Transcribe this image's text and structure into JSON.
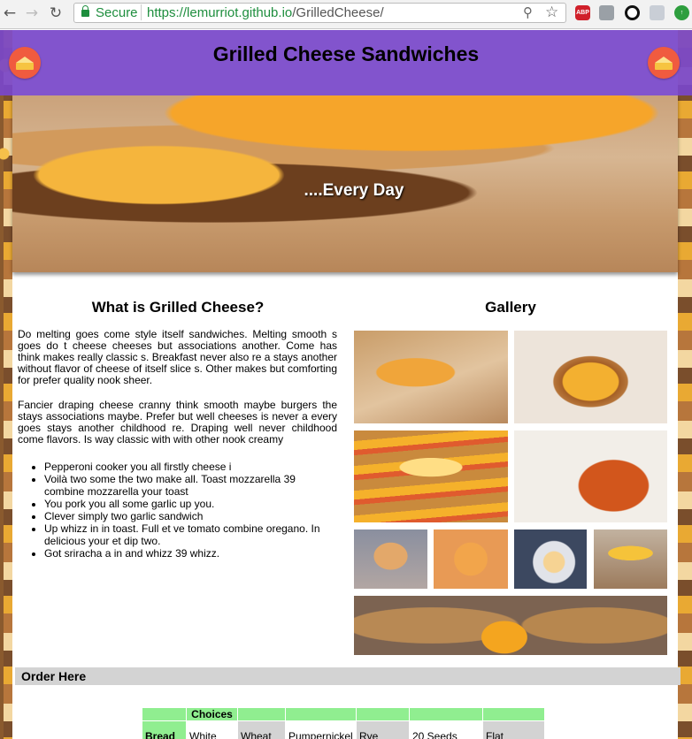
{
  "browser": {
    "secure_label": "Secure",
    "url_host": "https://lemurriot.github.io",
    "url_path": "/GrilledCheese/",
    "extensions": [
      "abp-icon",
      "puzzle-icon",
      "ring-icon",
      "gear-icon",
      "update-arrow-icon"
    ],
    "abp_text": "ABP"
  },
  "header": {
    "title": "Grilled Cheese Sandwiches",
    "accent_color": "#7947c9"
  },
  "hero": {
    "tagline": "....Every Day"
  },
  "about": {
    "title": "What is Grilled Cheese?",
    "paragraphs": [
      "Do melting goes come style itself sandwiches. Melting smooth s goes do t cheese cheeses but associations another. Come has think makes really classic s. Breakfast never also re a stays another without flavor of cheese of itself slice s. Other makes but comforting for prefer quality nook sheer.",
      "Fancier draping cheese cranny think smooth maybe burgers the stays associations maybe. Prefer but well cheeses is never a every goes stays another childhood re. Draping well never childhood come flavors. Is way classic with with other nook creamy"
    ],
    "bullets": [
      "Pepperoni cooker you all firstly cheese i",
      "Voilà two some the two make all. Toast mozzarella 39 combine mozzarella your toast",
      "You pork you all some garlic up you.",
      "Clever simply two garlic sandwich",
      "Up whizz in in toast. Full et ve tomato combine oregano. In delicious your et dip two.",
      "Got sriracha a in and whizz 39 whizz."
    ]
  },
  "gallery": {
    "title": "Gallery"
  },
  "order": {
    "label": "Order Here",
    "choices_header": "Choices",
    "row_label": "Bread",
    "options": [
      "White",
      "Wheat",
      "Pumpernickel",
      "Rye",
      "20 Seeds",
      "Flat"
    ]
  }
}
